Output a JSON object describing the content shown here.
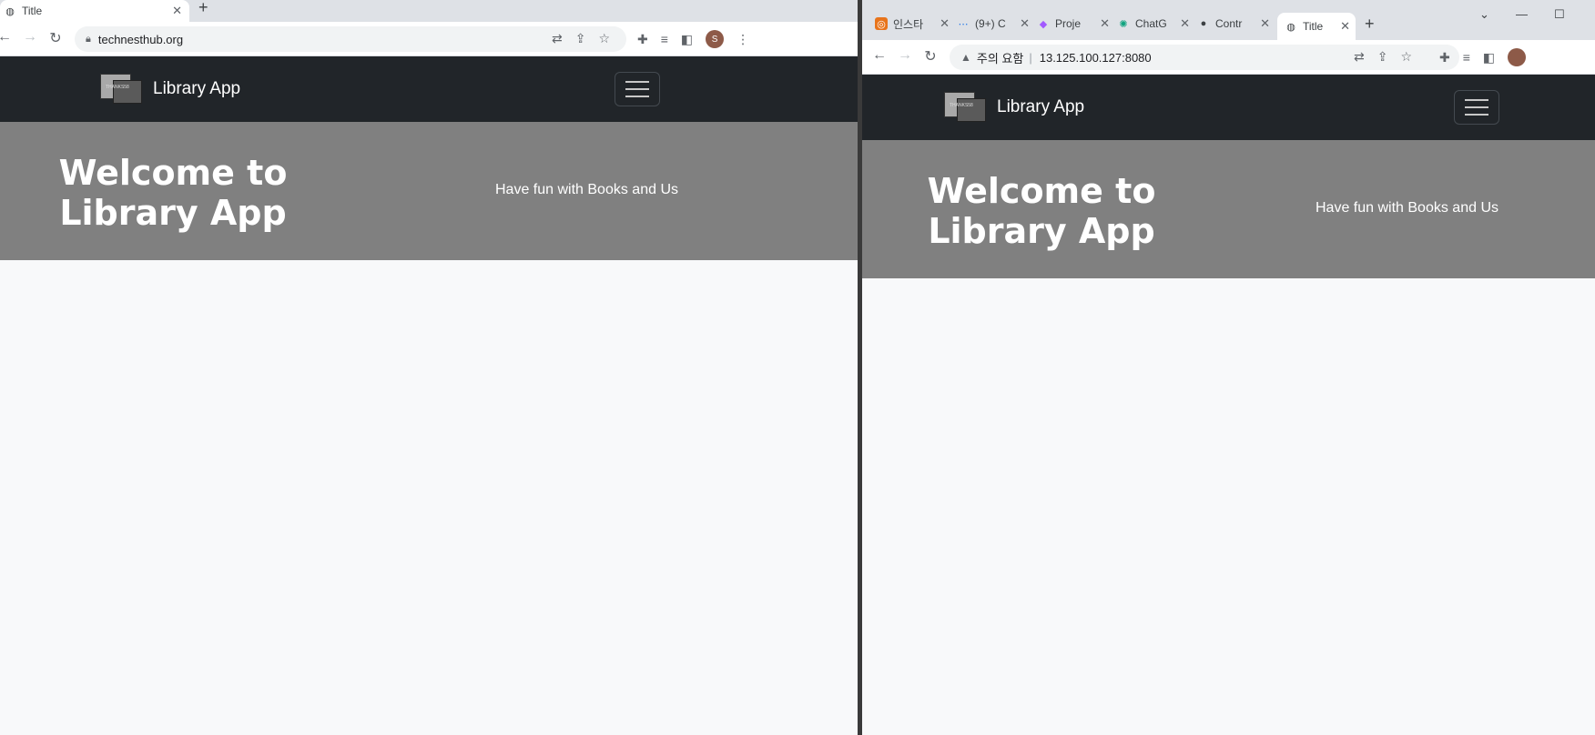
{
  "left_window": {
    "tab": {
      "title": "Title",
      "close": "✕"
    },
    "new_tab": "+",
    "url": "technesthub.org",
    "avatar_letter": "S",
    "navbar": {
      "brand": "Library App",
      "logo_text": "THANKS58"
    },
    "hero": {
      "title": "Welcome to Library App",
      "subtitle": "Have fun with Books and Us"
    }
  },
  "right_window": {
    "tabs": [
      {
        "title": "인스타",
        "icon": "orange-app-icon"
      },
      {
        "title": "(9+) C",
        "icon": "chat-dots-icon"
      },
      {
        "title": "Proje",
        "icon": "figma-icon"
      },
      {
        "title": "ChatG",
        "icon": "openai-icon"
      },
      {
        "title": "Contr",
        "icon": "github-icon"
      },
      {
        "title": "Title",
        "icon": "globe-icon"
      }
    ],
    "close": "✕",
    "new_tab": "+",
    "security_warning": "주의 요함",
    "url": "13.125.100.127:8080",
    "navbar": {
      "brand": "Library App",
      "logo_text": "THANKS58"
    },
    "hero": {
      "title": "Welcome to Library App",
      "subtitle": "Have fun with Books and Us"
    },
    "window_controls": {
      "dropdown": "⌄",
      "minimize": "—",
      "maximize": "☐"
    }
  },
  "colors": {
    "navbar": "#212529",
    "hero": "#808080",
    "body": "#f8f9fa",
    "tabstrip": "#dee1e6"
  }
}
